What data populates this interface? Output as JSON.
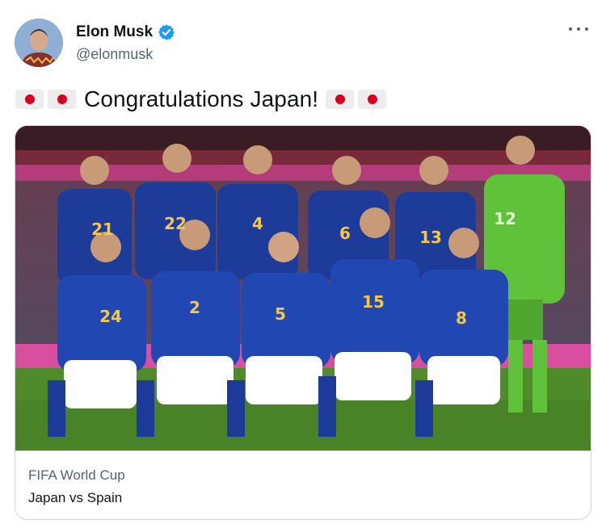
{
  "author": {
    "name": "Elon Musk",
    "handle": "@elonmusk",
    "verified": true
  },
  "tweet": {
    "text": "Congratulations Japan!",
    "emoji_left": [
      "flag-japan",
      "flag-japan"
    ],
    "emoji_right": [
      "flag-japan",
      "flag-japan"
    ]
  },
  "card": {
    "source": "FIFA World Cup",
    "title": "Japan vs Spain",
    "image_alt": "team-photo",
    "jersey_numbers_back": [
      "21",
      "22",
      "4",
      "6",
      "13"
    ],
    "jersey_number_keeper": "12",
    "jersey_numbers_front": [
      "24",
      "2",
      "5",
      "15",
      "8"
    ]
  },
  "colors": {
    "text": "#0f1419",
    "secondary": "#536471",
    "border": "#cfd9de",
    "verified": "#1d9bf0",
    "japan_red": "#d7001d",
    "jersey_blue": "#1d3c9a",
    "keeper_green": "#5fc23a",
    "pitch_green": "#4f8a2b",
    "pitch_pink": "#d94fa0"
  }
}
